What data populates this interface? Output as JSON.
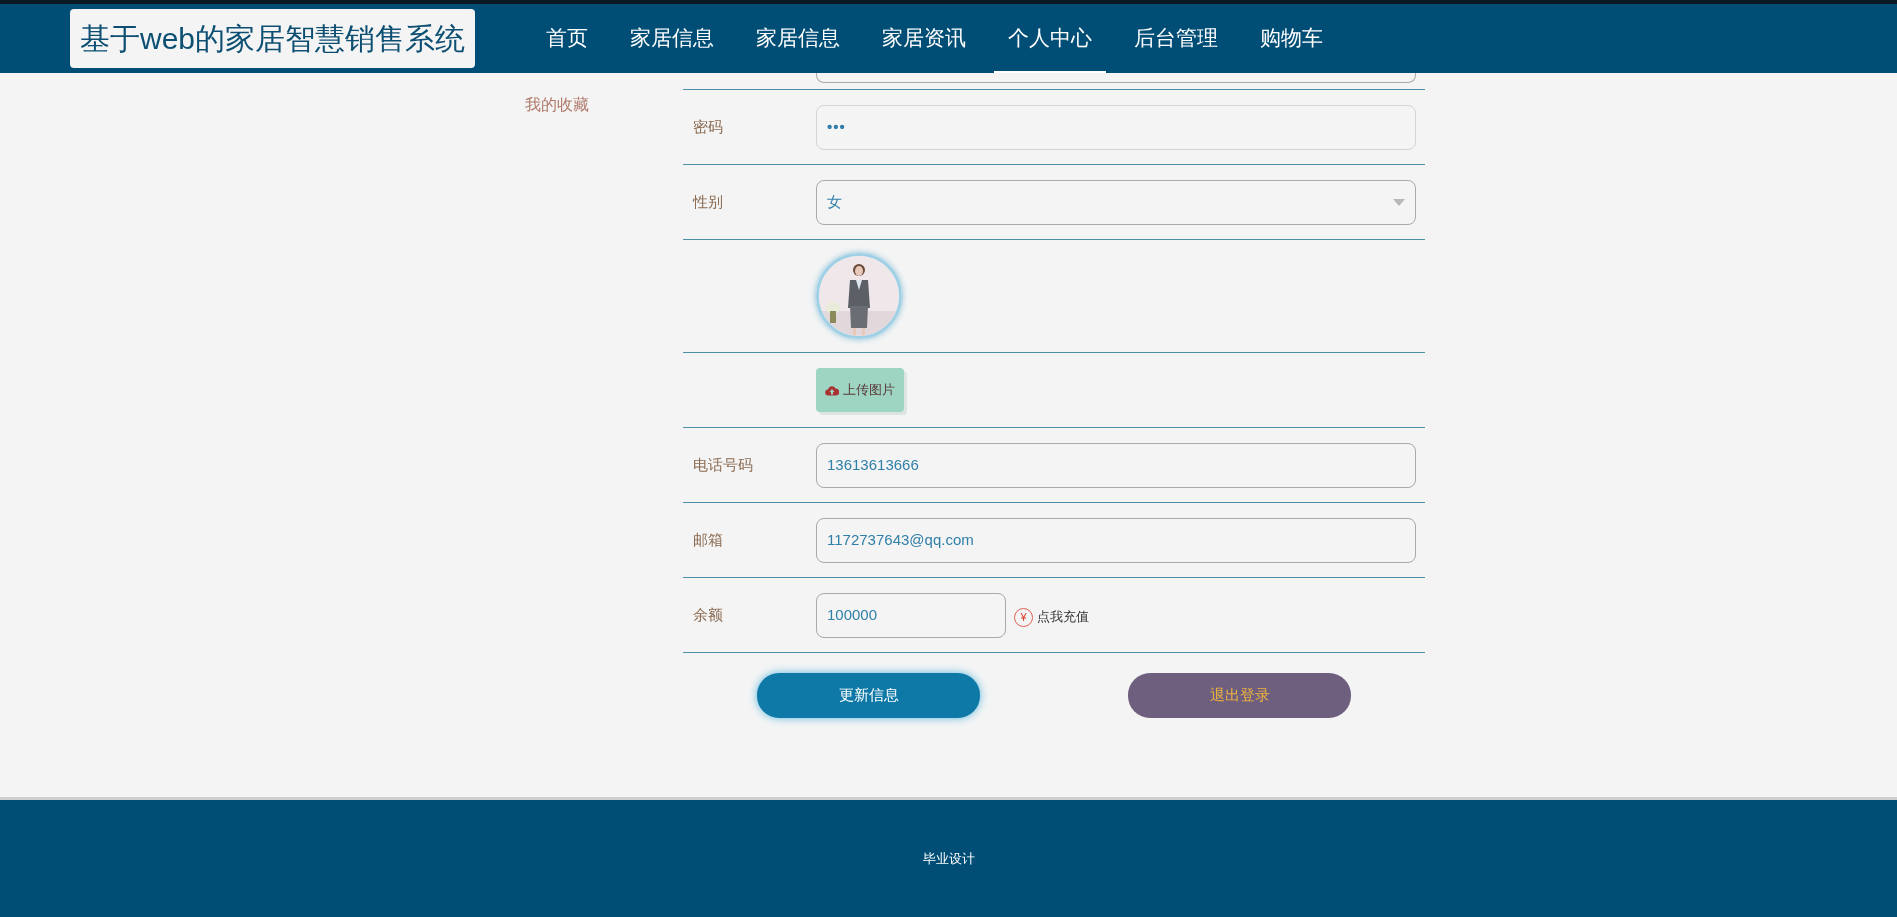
{
  "header": {
    "site_title": "基于web的家居智慧销售系统",
    "nav": [
      {
        "label": "首页",
        "selected": false
      },
      {
        "label": "家居信息",
        "selected": false
      },
      {
        "label": "家居信息",
        "selected": false
      },
      {
        "label": "家居资讯",
        "selected": false
      },
      {
        "label": "个人中心",
        "selected": true
      },
      {
        "label": "后台管理",
        "selected": false
      },
      {
        "label": "购物车",
        "selected": false
      }
    ]
  },
  "sidebar": {
    "items": [
      {
        "label": "我的收藏",
        "selected": false
      }
    ]
  },
  "form": {
    "rows": [
      {
        "kind": "password",
        "label": "密码",
        "value": "•••"
      },
      {
        "kind": "select",
        "label": "性别",
        "value": "女"
      },
      {
        "kind": "avatar"
      },
      {
        "kind": "upload",
        "button": "上传图片"
      },
      {
        "kind": "text",
        "label": "电话号码",
        "value": "13613613666"
      },
      {
        "kind": "text",
        "label": "邮箱",
        "value": "1172737643@qq.com"
      },
      {
        "kind": "balance",
        "label": "余额",
        "value": "100000",
        "action": "点我充值",
        "action_icon": "¥"
      }
    ],
    "buttons": [
      {
        "kind": "primary",
        "label": "更新信息"
      },
      {
        "kind": "secondary",
        "label": "退出登录"
      }
    ]
  },
  "footer": {
    "text": "毕业设计"
  }
}
